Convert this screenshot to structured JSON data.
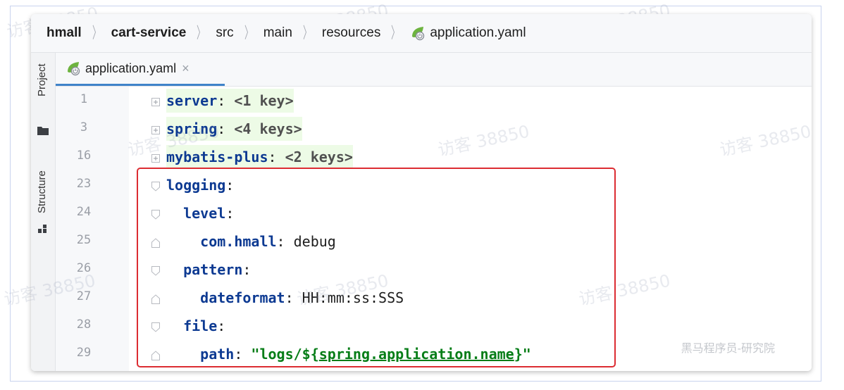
{
  "breadcrumb": {
    "items": [
      {
        "label": "hmall",
        "bold": true
      },
      {
        "label": "cart-service",
        "bold": true
      },
      {
        "label": "src",
        "bold": false
      },
      {
        "label": "main",
        "bold": false
      },
      {
        "label": "resources",
        "bold": false
      },
      {
        "label": "application.yaml",
        "bold": false,
        "icon": "spring-leaf-icon"
      }
    ],
    "separator": "〉"
  },
  "side_panel": {
    "project_label": "Project",
    "structure_label": "Structure"
  },
  "tab": {
    "label": "application.yaml",
    "close": "×",
    "icon": "spring-leaf-icon"
  },
  "editor": {
    "line_numbers": [
      "1",
      "3",
      "16",
      "23",
      "24",
      "25",
      "26",
      "27",
      "28",
      "29"
    ],
    "lines": {
      "l1": {
        "key": "server",
        "colon": ":",
        "collapsed": " <1 key>"
      },
      "l3": {
        "key": "spring",
        "colon": ":",
        "collapsed": " <4 keys>"
      },
      "l16": {
        "key": "mybatis-plus",
        "colon": ":",
        "collapsed": " <2 keys>"
      },
      "l23": {
        "key": "logging",
        "colon": ":"
      },
      "l24": {
        "indent": "  ",
        "key": "level",
        "colon": ":"
      },
      "l25": {
        "indent": "    ",
        "key": "com.hmall",
        "colon": ":",
        "value": " debug"
      },
      "l26": {
        "indent": "  ",
        "key": "pattern",
        "colon": ":"
      },
      "l27": {
        "indent": "    ",
        "key": "dateformat",
        "colon": ":",
        "value": " HH:mm:ss:SSS"
      },
      "l28": {
        "indent": "  ",
        "key": "file",
        "colon": ":"
      },
      "l29": {
        "indent": "    ",
        "key": "path",
        "colon": ":",
        "str_open": " \"logs/${",
        "str_mid": "spring.application.name",
        "str_close": "}\""
      }
    }
  },
  "watermark": {
    "text": "访客 38850",
    "credit": "黑马程序员-研究院"
  },
  "colors": {
    "key": "#0d3a92",
    "string": "#067d17",
    "highlight": "#edfbe6",
    "redbox": "#dc2c32",
    "tab_underline": "#4083c9"
  }
}
